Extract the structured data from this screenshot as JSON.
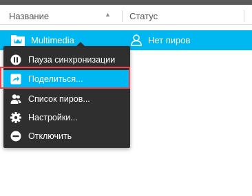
{
  "header": {
    "name_column": "Название",
    "status_column": "Статус",
    "sort_glyph": "▲"
  },
  "folder_row": {
    "name": "Multimedia",
    "status": "Нет пиров",
    "icon": "folder-icon"
  },
  "context_menu": {
    "items": [
      {
        "label": "Пауза синхронизации",
        "icon": "pause-icon"
      },
      {
        "label": "Поделиться...",
        "icon": "share-icon",
        "highlighted": true
      },
      {
        "label": "Список пиров...",
        "icon": "peers-icon"
      },
      {
        "label": "Настройки...",
        "icon": "gear-icon"
      },
      {
        "label": "Отключить",
        "icon": "disconnect-icon"
      }
    ]
  },
  "colors": {
    "accent": "#00b8f1",
    "menu_bg": "#2f2f2f",
    "highlight_border": "#e8454f"
  }
}
